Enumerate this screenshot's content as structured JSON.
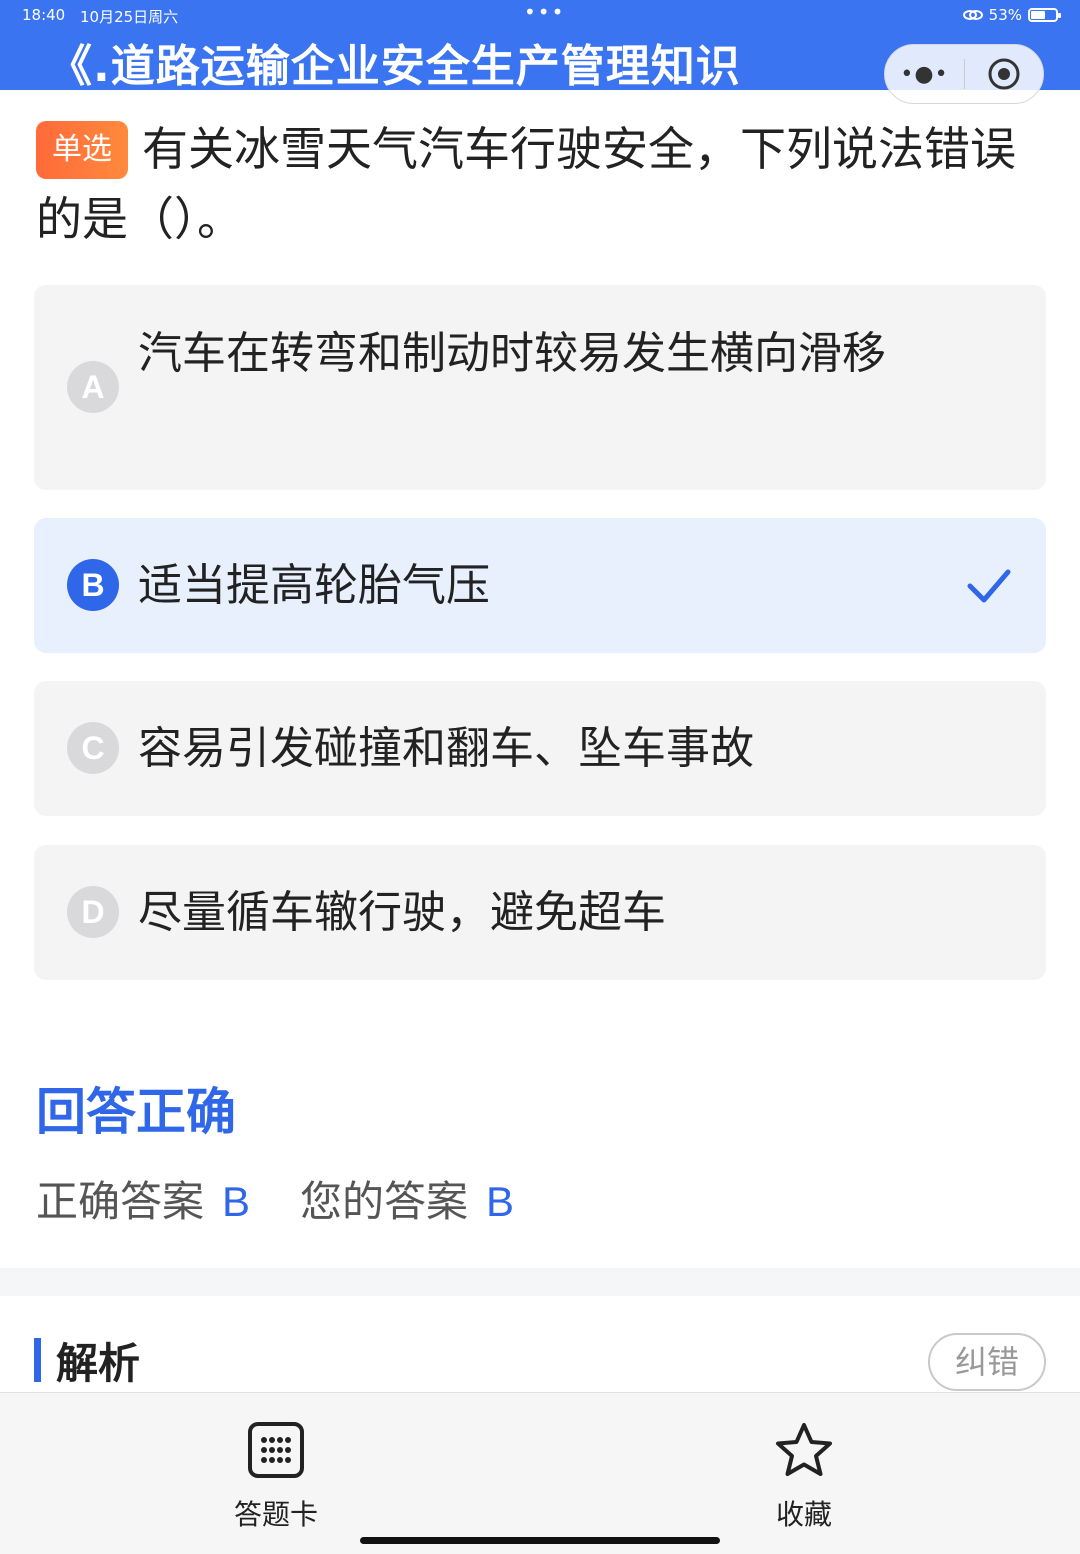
{
  "status_bar": {
    "time": "18:40",
    "date": "10月25日周六",
    "dots": "•••",
    "battery": "53%"
  },
  "header": {
    "title": "《.道路运输企业安全生产管理知识",
    "capsule_more": "•●•"
  },
  "question": {
    "type_label": "单选",
    "text": "有关冰雪天气汽车行驶安全，下列说法错误的是（）。"
  },
  "options": [
    {
      "letter": "A",
      "text": "汽车在转弯和制动时较易发生横向滑移",
      "selected": false
    },
    {
      "letter": "B",
      "text": "适当提高轮胎气压",
      "selected": true
    },
    {
      "letter": "C",
      "text": "容易引发碰撞和翻车、坠车事故",
      "selected": false
    },
    {
      "letter": "D",
      "text": "尽量循车辙行驶，避免超车",
      "selected": false
    }
  ],
  "result": {
    "title": "回答正确",
    "correct_label": "正确答案",
    "correct_value": "B",
    "yours_label": "您的答案",
    "yours_value": "B"
  },
  "analysis": {
    "title": "解析",
    "report_button": "纠错"
  },
  "bottom_bar": {
    "answer_card": "答题卡",
    "favorite": "收藏"
  },
  "colors": {
    "brand": "#3a74f1",
    "accent": "#2f67e8",
    "type_tag": "#ff7a3c",
    "selected_bg": "#e8effd"
  }
}
